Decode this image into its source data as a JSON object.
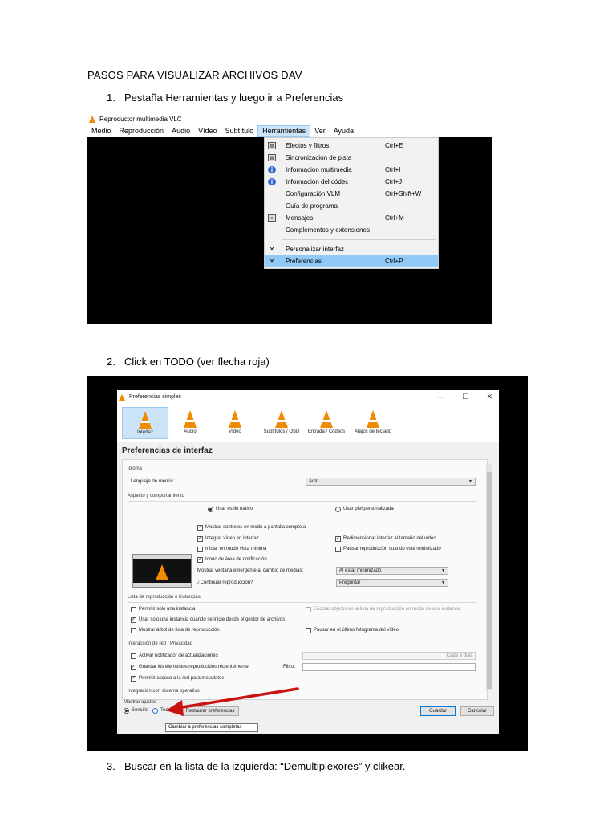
{
  "document": {
    "title": "PASOS PARA VISUALIZAR ARCHIVOS DAV",
    "steps": [
      {
        "num": "1.",
        "text": "Pestaña Herramientas y luego ir a Preferencias"
      },
      {
        "num": "2.",
        "text": "Click en TODO (ver flecha roja)"
      },
      {
        "num": "3.",
        "text": "Buscar en la lista de la izquierda: “Demultiplexores” y clikear."
      }
    ]
  },
  "vlc": {
    "window_title": "Reproductor multimedia VLC",
    "menu": [
      "Medio",
      "Reproducción",
      "Audio",
      "Vídeo",
      "Subtítulo",
      "Herramientas",
      "Ver",
      "Ayuda"
    ],
    "dropdown": [
      {
        "label": "Efectos y filtros",
        "shortcut": "Ctrl+E",
        "icon": "equalizer-icon"
      },
      {
        "label": "Sincronización de pista",
        "shortcut": "",
        "icon": "equalizer-icon"
      },
      {
        "label": "Información multimedia",
        "shortcut": "Ctrl+I",
        "icon": "info-icon"
      },
      {
        "label": "Información del códec",
        "shortcut": "Ctrl+J",
        "icon": "info-icon"
      },
      {
        "label": "Configuración VLM",
        "shortcut": "Ctrl+Shift+W",
        "icon": ""
      },
      {
        "label": "Guía de programa",
        "shortcut": "",
        "icon": ""
      },
      {
        "label": "Mensajes",
        "shortcut": "Ctrl+M",
        "icon": "messages-icon"
      },
      {
        "label": "Complementos y extensiones",
        "shortcut": "",
        "icon": ""
      },
      {
        "label": "Personalizar interfaz",
        "shortcut": "",
        "icon": "tools-icon"
      },
      {
        "label": "Preferencias",
        "shortcut": "Ctrl+P",
        "icon": "tools-icon"
      }
    ]
  },
  "prefs": {
    "window_title": "Preferencias simples",
    "win_buttons": [
      "—",
      "☐",
      "✕"
    ],
    "toolbar": [
      "Interfaz",
      "Audio",
      "Vídeo",
      "Subtítulos / OSD",
      "Entrada / Códecs",
      "Atajos de teclado"
    ],
    "heading": "Preferencias de interfaz",
    "idioma": {
      "section": "Idioma",
      "label": "Lenguaje de menús:",
      "value": "Auto"
    },
    "aspecto": {
      "section": "Aspecto y comportamiento",
      "native": "Usar estilo nativo",
      "custom": "Usar piel personalizada",
      "checks_left": [
        "Mostrar controles en modo a pantalla completa",
        "Integrar vídeo en interfaz",
        "Iniciar en modo vista mínima",
        "Icono de área de notificación"
      ],
      "checks_right": [
        "Redimensionar interfaz al tamaño del vídeo",
        "Pausar reproducción cuando esté minimizado"
      ],
      "popup_label": "Mostrar ventana emergente al cambio de medias:",
      "popup_value": "Al estar minimizado",
      "continue_label": "¿Continuar reproducción?",
      "continue_value": "Preguntar"
    },
    "playlist": {
      "section": "Lista de reproducción e instancias",
      "single": "Permitir solo una instancia",
      "enqueue": "Encolar objetos en la lista de reproducción en modo de una instancia",
      "file_manager": "Usar solo una instancia cuando se inicie desde el gestor de archivos",
      "tree": "Mostrar árbol de lista de reproducción",
      "pause_last": "Pausar en el último fotograma del vídeo"
    },
    "network": {
      "section": "Interacción de red / Privacidad",
      "updates": "Activar notificador de actualizaciones",
      "updates_value": "Cada 3 días",
      "recent": "Guardar los elementos reproducidos recientemente",
      "filter_label": "Filtro:",
      "metadata": "Permitir acceso a la red para metadatos"
    },
    "os_section": "Integración con sistema operativo",
    "show_settings": "Mostrar ajustes",
    "simple": "Sencillo",
    "all": "Todo",
    "reset": "Restaurar preferencias",
    "save": "Guardar",
    "cancel": "Cancelar",
    "tooltip": "Cambiar a preferencias completas",
    "arrow_color": "#cc1111"
  }
}
